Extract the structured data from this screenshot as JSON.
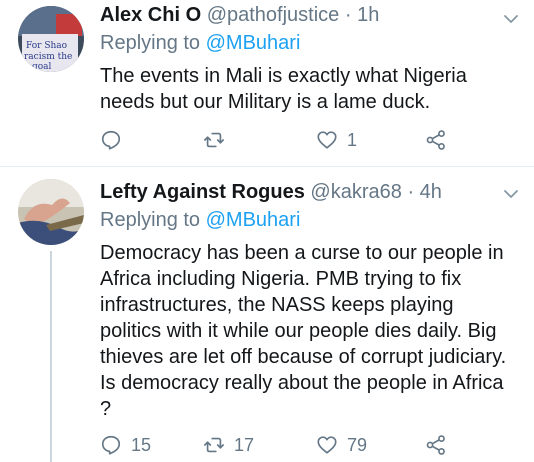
{
  "tweets": [
    {
      "name": "Alex Chi O",
      "handle": "@pathofjustice",
      "separator": "·",
      "time": "1h",
      "replying_prefix": "Replying to",
      "replying_to": "@MBuhari",
      "text": "The events in Mali is exactly what Nigeria needs but our Military is a lame duck.",
      "avatar_text": [
        "For Shao",
        "racism the",
        "goal"
      ],
      "counts": {
        "replies": "",
        "retweets": "",
        "likes": "1"
      }
    },
    {
      "name": "Lefty Against Rogues",
      "handle": "@kakra68",
      "separator": "·",
      "time": "4h",
      "replying_prefix": "Replying to",
      "replying_to": "@MBuhari",
      "text": "Democracy has been a curse to our people in Africa including Nigeria. PMB trying to fix infrastructures, the NASS keeps playing politics with it while our people dies daily. Big thieves are let off because of corrupt judiciary. Is democracy really about the people in Africa ?",
      "counts": {
        "replies": "15",
        "retweets": "17",
        "likes": "79"
      }
    }
  ],
  "colors": {
    "accent": "#1da1f2",
    "muted": "#657786",
    "text": "#14171a",
    "divider": "#e6ecf0"
  },
  "icons": [
    "reply-icon",
    "retweet-icon",
    "like-icon",
    "share-icon",
    "chevron-down-icon"
  ]
}
